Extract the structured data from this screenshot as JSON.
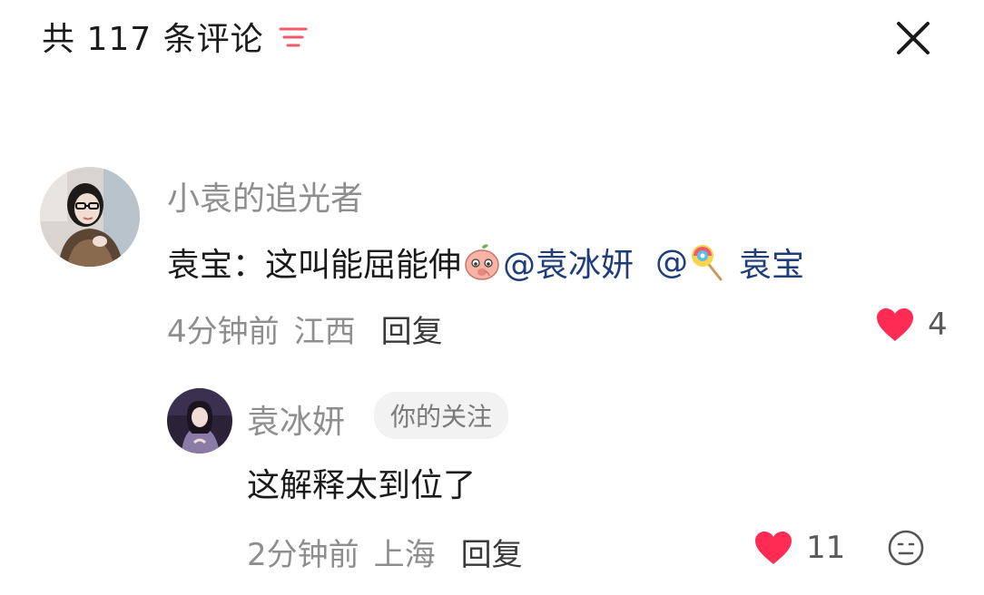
{
  "header": {
    "title": "共 117 条评论",
    "filter_icon": "filter-lines-icon",
    "close_icon": "close-icon"
  },
  "comments": [
    {
      "username": "小袁的追光者",
      "content_text": "袁宝：这叫能屈能伸",
      "emoji_1": "peach-face-emoji",
      "mention_1": "@袁冰妍",
      "mention_2_prefix": "@",
      "emoji_2": "lollipop-emoji",
      "mention_2_name": "袁宝",
      "time": "4分钟前",
      "location": "江西",
      "reply_label": "回复",
      "like_count": "4",
      "replies": [
        {
          "username": "袁冰妍",
          "badge": "你的关注",
          "content_text": "这解释太到位了",
          "time": "2分钟前",
          "location": "上海",
          "reply_label": "回复",
          "like_count": "11",
          "emoji_button_icon": "emoji-face-icon"
        }
      ]
    }
  ],
  "colors": {
    "like_red": "#fe2c55",
    "filter_red": "#f25a6a",
    "mention_blue": "#1f3d7a",
    "meta_gray": "#8e8e8e"
  }
}
